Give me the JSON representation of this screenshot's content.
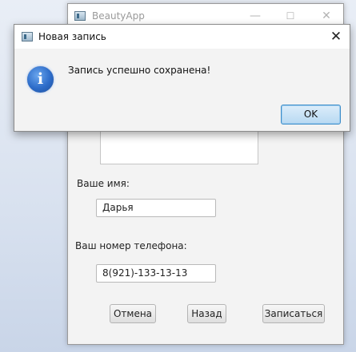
{
  "main_window": {
    "title": "BeautyApp",
    "controls": {
      "minimize": "—",
      "maximize": "☐",
      "close": "✕"
    },
    "form": {
      "name_label": "Ваше имя:",
      "name_value": "Дарья",
      "phone_label": "Ваш номер телефона:",
      "phone_value": "8(921)-133-13-13",
      "cancel_label": "Отмена",
      "back_label": "Назад",
      "submit_label": "Записаться"
    }
  },
  "dialog": {
    "title": "Новая запись",
    "close_glyph": "✕",
    "icon_glyph": "i",
    "message": "Запись успешно сохранена!",
    "ok_label": "OK"
  },
  "colors": {
    "ok_button_border": "#3d8dc9",
    "info_icon": "#2d6cc9"
  }
}
